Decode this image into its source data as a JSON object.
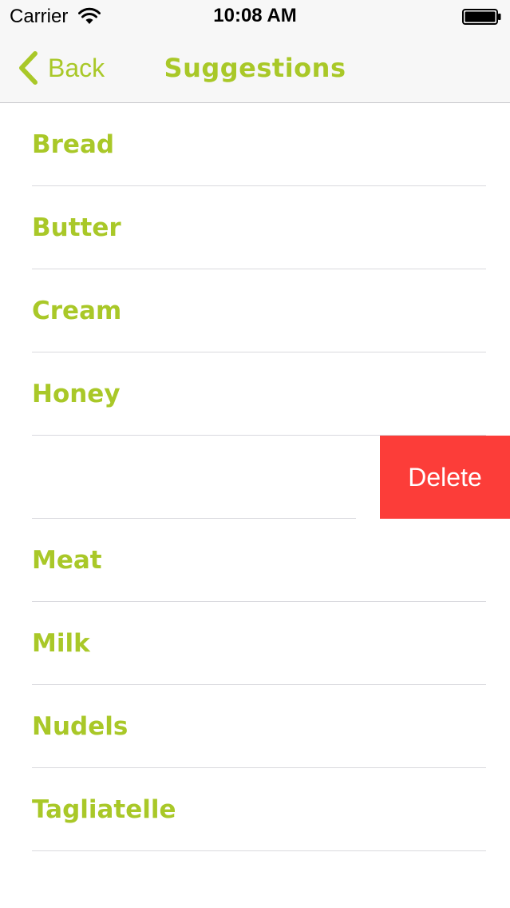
{
  "status_bar": {
    "carrier": "Carrier",
    "time": "10:08 AM",
    "wifi_icon": "wifi-icon",
    "battery_icon": "battery-icon"
  },
  "nav": {
    "back_label": "Back",
    "back_icon": "chevron-left-icon",
    "title": "Suggestions"
  },
  "list": {
    "items": [
      {
        "label": "Bread"
      },
      {
        "label": "Butter"
      },
      {
        "label": "Cream"
      },
      {
        "label": "Honey"
      },
      {
        "label": "",
        "swiped": true,
        "action_label": "Delete"
      },
      {
        "label": "Meat"
      },
      {
        "label": "Milk"
      },
      {
        "label": "Nudels"
      },
      {
        "label": "Tagliatelle"
      }
    ]
  },
  "colors": {
    "accent": "#a9c828",
    "danger": "#fc3d39",
    "bar_background": "#f7f7f7"
  }
}
